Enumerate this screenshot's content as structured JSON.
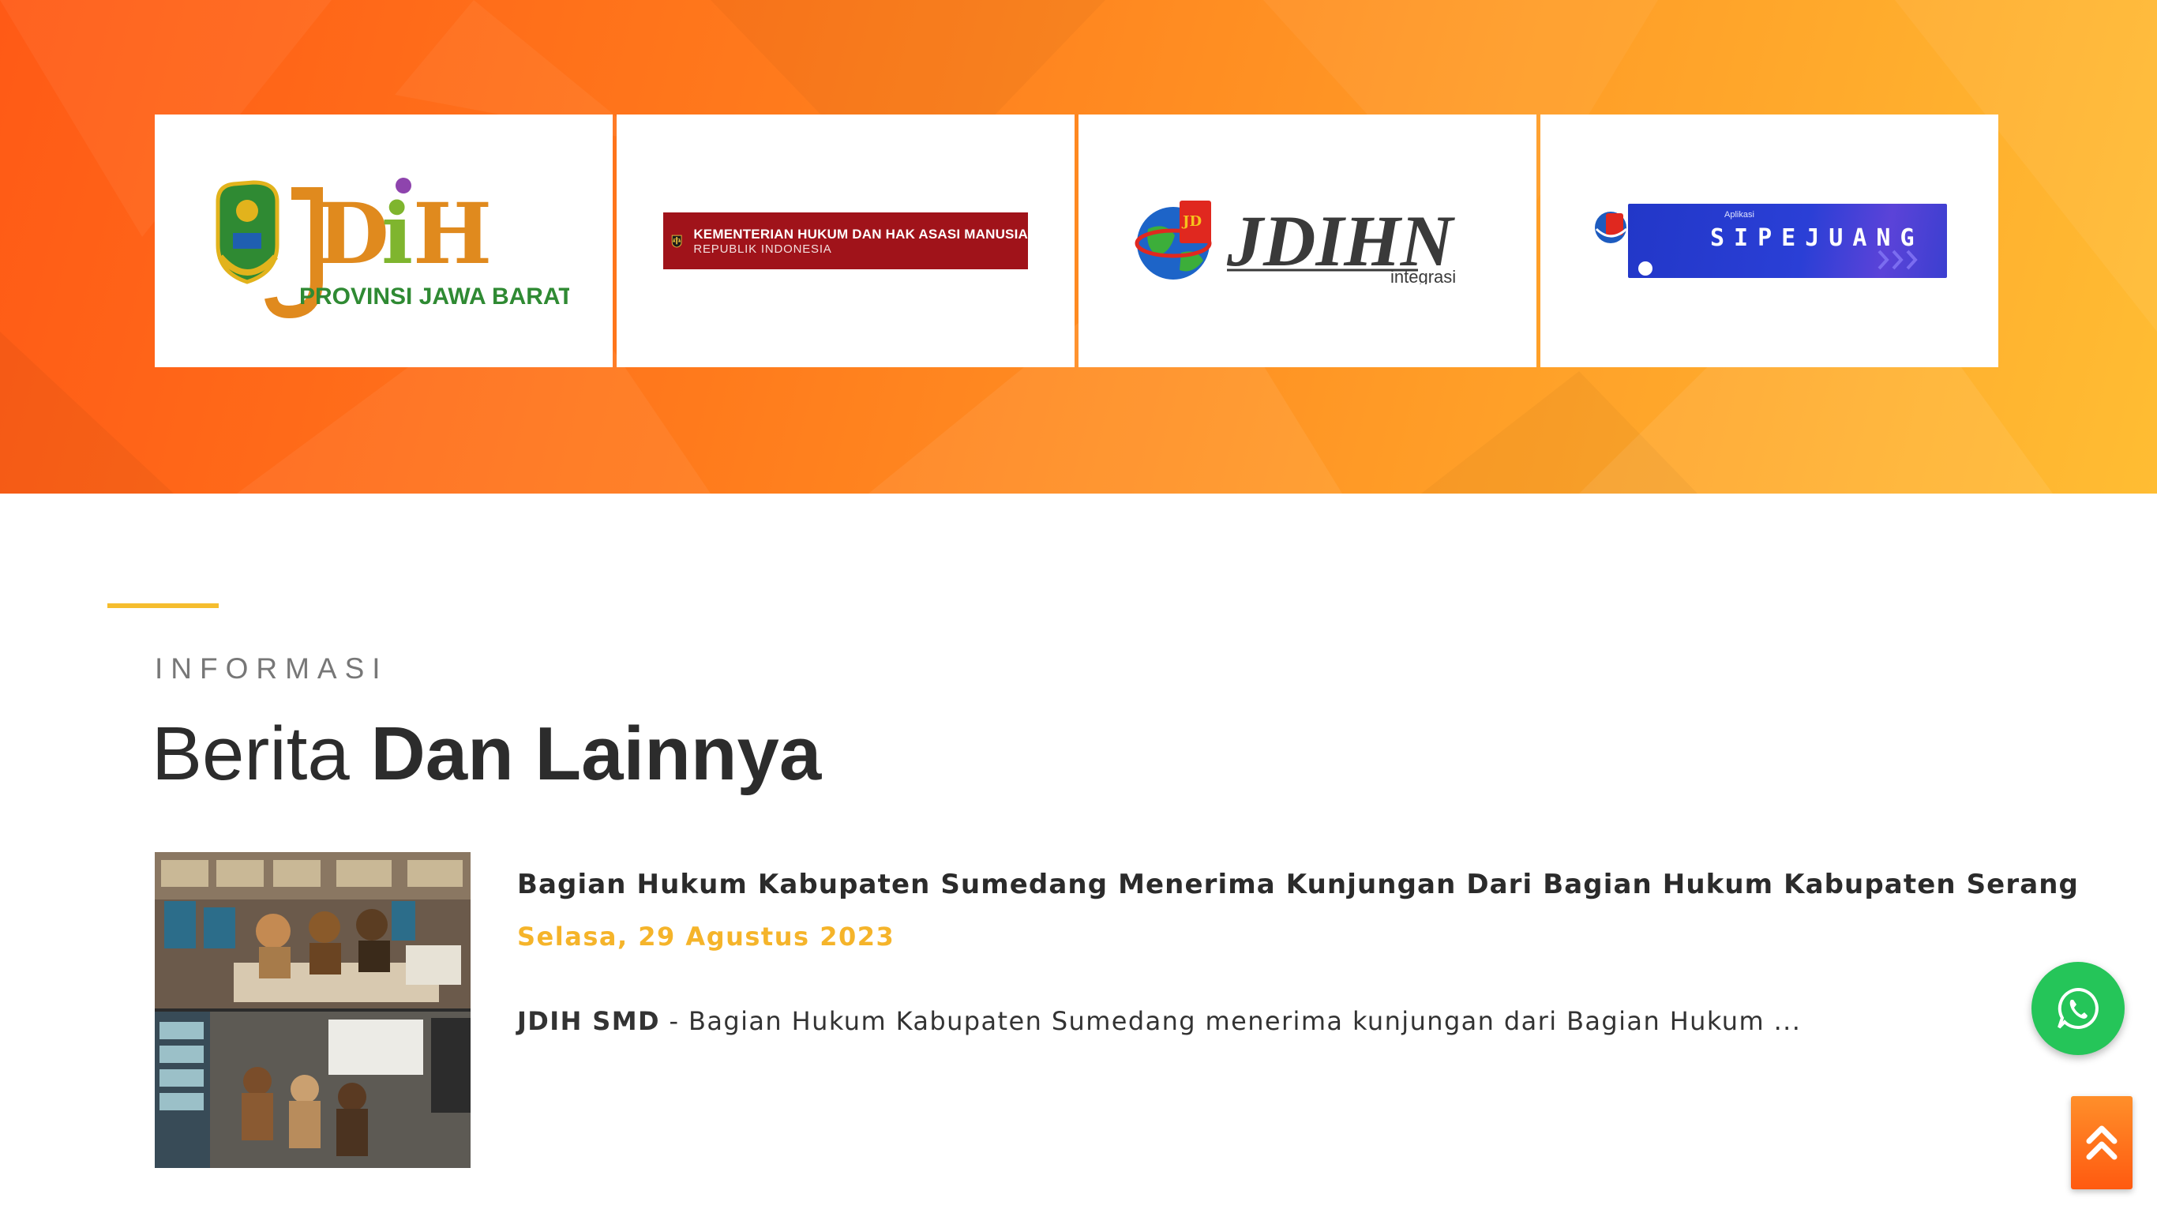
{
  "partners": {
    "card1": {
      "logo_text": "JDiH",
      "subtitle": "PROVINSI JAWA BARAT",
      "icon": "west-java-emblem-icon"
    },
    "card2": {
      "line1": "KEMENTERIAN HUKUM DAN HAK ASASI MANUSIA",
      "line2": "REPUBLIK INDONESIA",
      "icon": "kemenkumham-emblem-icon"
    },
    "card3": {
      "logo_text": "JDIHN",
      "subtitle": "integrasi",
      "icon": "globe-icon"
    },
    "card4": {
      "small_label": "Aplikasi",
      "main_label": "SIPEJUANG",
      "icon": "sumedang-emblem-icon"
    }
  },
  "section": {
    "label": "INFORMASI",
    "title_light": "Berita",
    "title_bold": "Dan Lainnya"
  },
  "news": [
    {
      "title": "Bagian Hukum Kabupaten Sumedang Menerima Kunjungan Dari Bagian Hukum Kabupaten Serang",
      "date": "Selasa, 29 Agustus 2023",
      "source": "JDIH SMD",
      "excerpt": " - Bagian Hukum Kabupaten Sumedang menerima kunjungan dari Bagian Hukum ..."
    }
  ],
  "floating": {
    "whatsapp_icon": "whatsapp-icon",
    "back_to_top_icon": "double-chevron-up-icon"
  },
  "colors": {
    "accent": "#f5bd2e",
    "date": "#f5b42a",
    "whatsapp": "#25c559",
    "hero_start": "#ff5a16",
    "hero_end": "#ffbd33"
  }
}
